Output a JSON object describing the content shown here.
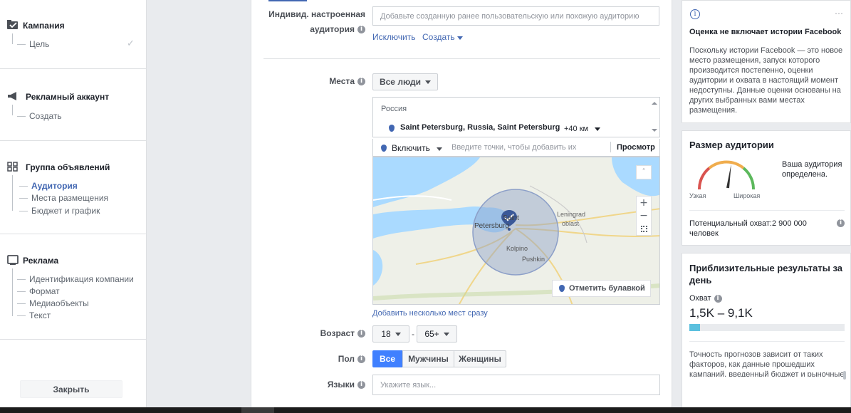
{
  "nav": {
    "sections": [
      {
        "title": "Кампания",
        "items": [
          "Цель"
        ]
      },
      {
        "title": "Рекламный аккаунт",
        "items": [
          "Создать"
        ]
      },
      {
        "title": "Группа объявлений",
        "items": [
          "Аудитория",
          "Места размещения",
          "Бюджет и график"
        ]
      },
      {
        "title": "Реклама",
        "items": [
          "Идентификация компании",
          "Формат",
          "Медиаобъекты",
          "Текст"
        ]
      }
    ],
    "close_label": "Закрыть"
  },
  "audience": {
    "custom_label_1": "Индивид. настроенная",
    "custom_label_2": "аудитория",
    "custom_placeholder": "Добавьте созданную ранее пользовательскую или похожую аудиторию",
    "exclude_link": "Исключить",
    "create_link": "Создать",
    "places_label": "Места",
    "people_dropdown": "Все люди",
    "country": "Россия",
    "location": "Saint Petersburg, Russia, Saint Petersburg",
    "radius": "+40 км",
    "include_dropdown": "Включить",
    "points_placeholder": "Введите точки, чтобы добавить их",
    "browse_link": "Просмотр",
    "map": {
      "labels": [
        "Saint",
        "Petersburg",
        "Leningrad",
        "oblast",
        "Kolpino",
        "Pushkin"
      ],
      "drop_pin_label": "Отметить булавкой"
    },
    "add_multiple_link": "Добавить несколько мест сразу",
    "age_label": "Возраст",
    "age_min": "18",
    "age_max": "65+",
    "age_sep": "-",
    "gender_label": "Пол",
    "gender_options": [
      "Все",
      "Мужчины",
      "Женщины"
    ],
    "gender_selected": "Все",
    "languages_label": "Языки",
    "languages_placeholder": "Укажите язык..."
  },
  "notice": {
    "more": "···",
    "title": "Оценка не включает истории Facebook",
    "lines": [
      "Поскольку истории Facebook — это новое",
      "место размещения, запуск которого",
      "производится постепенно, оценки",
      "аудитории и охвата в настоящий момент",
      "недоступны. Данные оценки основаны на",
      "других выбранных вами местах",
      "размещения."
    ]
  },
  "audience_size": {
    "title": "Размер аудитории",
    "status_1": "Ваша аудитория",
    "status_2": "определена.",
    "narrow": "Узкая",
    "wide": "Широкая",
    "reach_1": "Потенциальный охват:2 900 000",
    "reach_2": "человек",
    "gauge_level": 0.55
  },
  "results": {
    "title_1": "Приблизительные результаты за",
    "title_2": "день",
    "reach_label": "Охват",
    "reach_value": "1,5K – 9,1K",
    "bar_level": 0.07,
    "note_lines": [
      "Точность прогнозов зависит от таких",
      "факторов, как данные прошедших",
      "кампаний, введенный бюджет и рыночные"
    ]
  },
  "colors": {
    "accent": "#4267b2",
    "active_btn": "#4080ff",
    "reach_bar": "#5bc0de",
    "map_water": "#aadaff",
    "map_land": "#eef0e8"
  }
}
